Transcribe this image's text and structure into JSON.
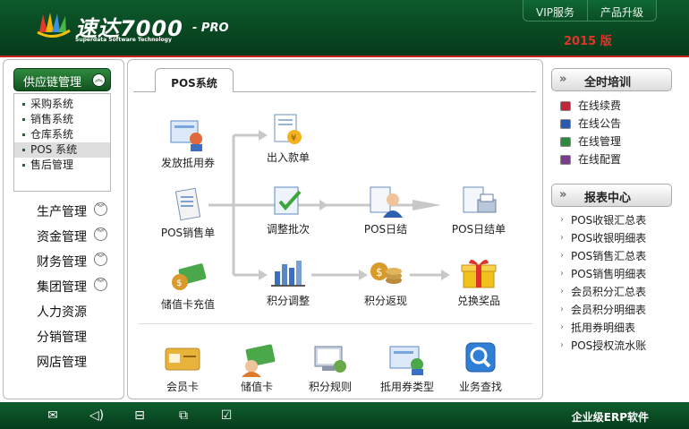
{
  "header": {
    "logo_title": "速达7000",
    "logo_suffix": "- PRO",
    "logo_subtitle": "Superdata Software Technology",
    "year_label": "2015 版",
    "top_buttons": [
      "VIP服务",
      "产品升级"
    ]
  },
  "sidebar": {
    "active_group": "供应链管理",
    "sub_items": [
      "采购系统",
      "销售系统",
      "仓库系统",
      "POS 系统",
      "售后管理"
    ],
    "active_sub_index": 3,
    "menu": [
      "生产管理",
      "资金管理",
      "财务管理",
      "集团管理",
      "人力资源",
      "分销管理",
      "网店管理"
    ]
  },
  "main": {
    "tab": "POS系统",
    "flow_tiles": [
      "发放抵用券",
      "出入款单",
      "POS销售单",
      "调整批次",
      "POS日结",
      "POS日结单",
      "储值卡充值",
      "积分调整",
      "积分返现",
      "兑换奖品"
    ],
    "bottom_tiles": [
      "会员卡",
      "储值卡",
      "积分规则",
      "抵用券类型",
      "业务查找"
    ]
  },
  "right": {
    "training_title": "全时培训",
    "training_items": [
      "在线续费",
      "在线公告",
      "在线管理",
      "在线配置"
    ],
    "training_colors": [
      "#c0283a",
      "#2a5bb0",
      "#2f8a3e",
      "#7a3d8c"
    ],
    "report_title": "报表中心",
    "report_items": [
      "POS收银汇总表",
      "POS收银明细表",
      "POS销售汇总表",
      "POS销售明细表",
      "会员积分汇总表",
      "会员积分明细表",
      "抵用券明细表",
      "POS授权流水账"
    ]
  },
  "footer": {
    "icons": [
      "mail-icon",
      "speaker-icon",
      "book-icon",
      "copy-icon",
      "check-circle-icon"
    ],
    "brand_text": "企业级ERP软件"
  }
}
